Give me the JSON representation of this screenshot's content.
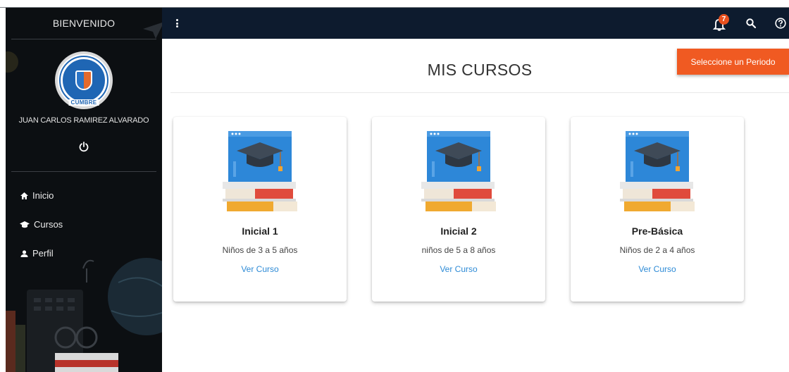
{
  "sidebar": {
    "title": "BIENVENIDO",
    "logo_text": "CUMBRE",
    "username": "JUAN CARLOS RAMIREZ ALVARADO",
    "nav": [
      {
        "label": "Inicio",
        "icon": "home-icon"
      },
      {
        "label": "Cursos",
        "icon": "graduation-cap-icon"
      },
      {
        "label": "Perfil",
        "icon": "user-icon"
      }
    ]
  },
  "topbar": {
    "notification_count": "7"
  },
  "period_button": "Seleccione un Periodo",
  "main": {
    "title": "MIS CURSOS",
    "courses": [
      {
        "title": "Inicial 1",
        "subtitle": "Niños de 3 a 5 años",
        "link": "Ver Curso"
      },
      {
        "title": "Inicial 2",
        "subtitle": "niños de 5 a 8 años",
        "link": "Ver Curso"
      },
      {
        "title": "Pre-Básica",
        "subtitle": "Niños de 2 a 4 años",
        "link": "Ver Curso"
      }
    ]
  },
  "colors": {
    "sidebar_bg": "#0c0f12",
    "topbar_bg": "#0d1b2e",
    "accent": "#f05a22",
    "link": "#2e8bd6"
  }
}
